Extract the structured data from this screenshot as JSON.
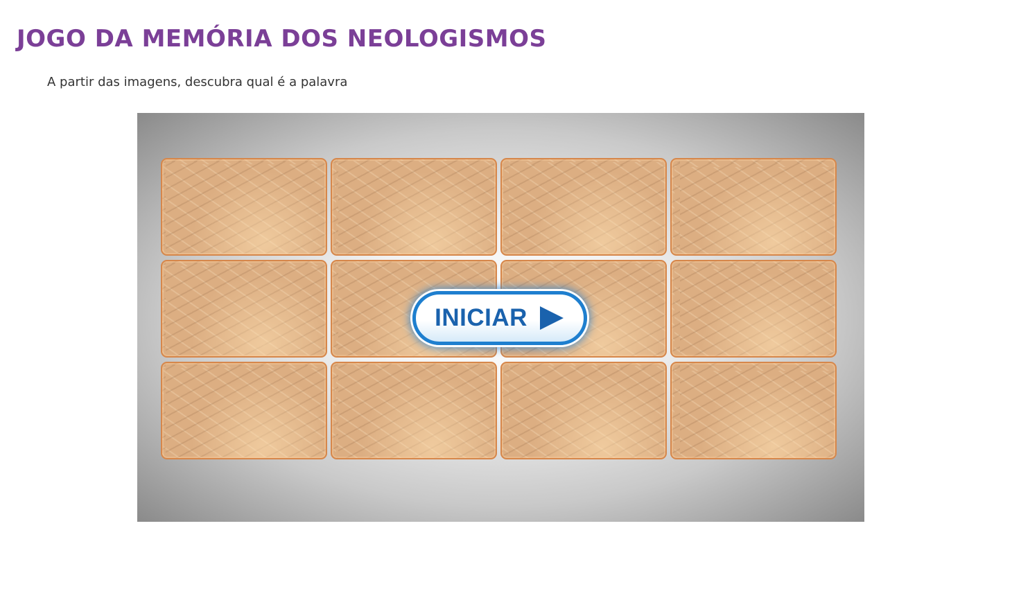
{
  "page": {
    "title": "JOGO DA MEMÓRIA DOS NEOLOGISMOS",
    "subtitle": "A partir das imagens, descubra qual é a palavra"
  },
  "game": {
    "start_button_label": "INICIAR",
    "start_icon": "play-triangle-icon",
    "grid": {
      "rows": 3,
      "columns": 4,
      "card_count": 12,
      "cards_face_down": true
    },
    "card_back_pattern": "lowercase-letters-pattern",
    "colors": {
      "title": "#7b3f97",
      "card_back": "#dcae82",
      "card_border": "#d6874b",
      "button_border": "#1e7fcf",
      "button_text": "#1a62ad"
    }
  }
}
